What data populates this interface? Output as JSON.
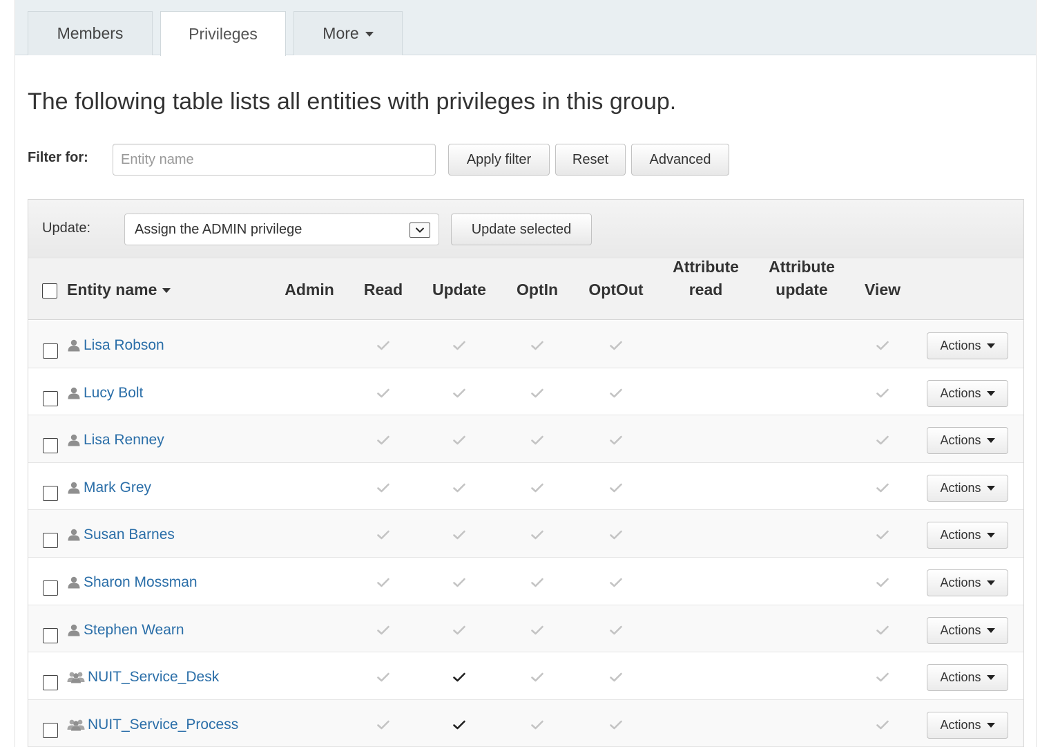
{
  "tabs": [
    {
      "label": "Members",
      "active": false
    },
    {
      "label": "Privileges",
      "active": true
    },
    {
      "label": "More",
      "active": false,
      "dropdown": true
    }
  ],
  "intro_text": "The following table lists all entities with privileges in this group.",
  "filter": {
    "label": "Filter for:",
    "placeholder": "Entity name",
    "value": "",
    "apply_label": "Apply filter",
    "reset_label": "Reset",
    "advanced_label": "Advanced"
  },
  "update_bar": {
    "label": "Update:",
    "selected_option": "Assign the ADMIN privilege",
    "update_selected_label": "Update selected"
  },
  "columns": {
    "entity_name": "Entity name",
    "admin": "Admin",
    "read": "Read",
    "update": "Update",
    "optin": "OptIn",
    "optout": "OptOut",
    "attribute_read_1": "Attribute",
    "attribute_read_2": "read",
    "attribute_update_1": "Attribute",
    "attribute_update_2": "update",
    "view": "View"
  },
  "actions_label": "Actions",
  "colors": {
    "link": "#2a6ea8",
    "check_inherited": "#c4c4c4",
    "check_direct": "#222222",
    "tabbar_bg": "#e9eff2"
  },
  "rows": [
    {
      "name": "Lisa Robson",
      "type": "person",
      "read": "inherited",
      "update": "inherited",
      "optin": "inherited",
      "optout": "inherited",
      "view": "inherited"
    },
    {
      "name": "Lucy Bolt",
      "type": "person",
      "read": "inherited",
      "update": "inherited",
      "optin": "inherited",
      "optout": "inherited",
      "view": "inherited"
    },
    {
      "name": "Lisa Renney",
      "type": "person",
      "read": "inherited",
      "update": "inherited",
      "optin": "inherited",
      "optout": "inherited",
      "view": "inherited"
    },
    {
      "name": "Mark Grey",
      "type": "person",
      "read": "inherited",
      "update": "inherited",
      "optin": "inherited",
      "optout": "inherited",
      "view": "inherited"
    },
    {
      "name": "Susan Barnes",
      "type": "person",
      "read": "inherited",
      "update": "inherited",
      "optin": "inherited",
      "optout": "inherited",
      "view": "inherited"
    },
    {
      "name": "Sharon Mossman",
      "type": "person",
      "read": "inherited",
      "update": "inherited",
      "optin": "inherited",
      "optout": "inherited",
      "view": "inherited"
    },
    {
      "name": "Stephen Wearn",
      "type": "person",
      "read": "inherited",
      "update": "inherited",
      "optin": "inherited",
      "optout": "inherited",
      "view": "inherited"
    },
    {
      "name": "NUIT_Service_Desk",
      "type": "group",
      "read": "inherited",
      "update": "direct",
      "optin": "inherited",
      "optout": "inherited",
      "view": "inherited"
    },
    {
      "name": "NUIT_Service_Process",
      "type": "group",
      "read": "inherited",
      "update": "direct",
      "optin": "inherited",
      "optout": "inherited",
      "view": "inherited"
    }
  ]
}
